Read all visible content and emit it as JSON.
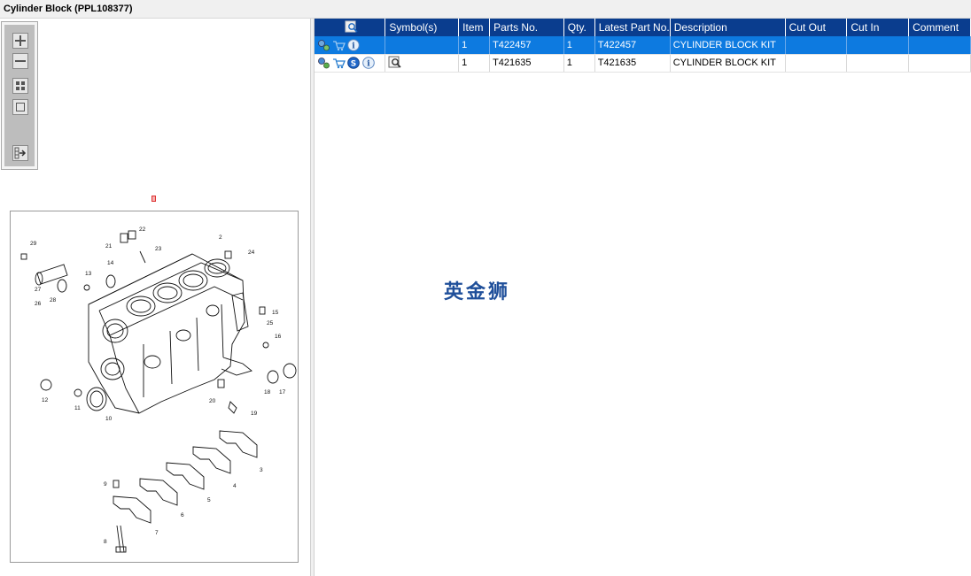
{
  "window": {
    "title": "Cylinder Block (PPL108377)"
  },
  "zoom_toolbar": [
    {
      "name": "zoom-in-icon"
    },
    {
      "name": "zoom-out-icon"
    },
    {
      "name": "fit-grid-icon"
    },
    {
      "name": "actual-size-icon"
    },
    {
      "name": "export-list-icon"
    }
  ],
  "grid": {
    "header_icon": "search-document-icon",
    "columns": [
      "Symbol(s)",
      "Item",
      "Parts No.",
      "Qty.",
      "Latest Part No.",
      "Description",
      "Cut Out",
      "Cut In",
      "Comment"
    ],
    "rows": [
      {
        "selected": true,
        "icons": [
          "gear-icon",
          "cart-icon",
          "info-icon"
        ],
        "symbol": "",
        "item": "1",
        "part_no": "T422457",
        "qty": "1",
        "latest": "T422457",
        "description": "CYLINDER BLOCK KIT",
        "cut_out": "",
        "cut_in": "",
        "comment": ""
      },
      {
        "selected": false,
        "icons": [
          "gear-icon",
          "cart-icon",
          "s-icon",
          "info-icon"
        ],
        "symbol": "search-document-icon",
        "item": "1",
        "part_no": "T421635",
        "qty": "1",
        "latest": "T421635",
        "description": "CYLINDER BLOCK KIT",
        "cut_out": "",
        "cut_in": "",
        "comment": ""
      }
    ]
  },
  "watermark": "英金狮",
  "diagram": {
    "callouts": [
      "29",
      "21",
      "22",
      "23",
      "2",
      "24",
      "14",
      "13",
      "27",
      "28",
      "26",
      "15",
      "25",
      "16",
      "12",
      "11",
      "10",
      "20",
      "19",
      "18",
      "17",
      "3",
      "4",
      "5",
      "6",
      "7",
      "9",
      "8"
    ]
  },
  "colors": {
    "header_bg": "#0a3d8e",
    "selected_row": "#0d7ae0",
    "watermark": "#1f4f9a"
  }
}
